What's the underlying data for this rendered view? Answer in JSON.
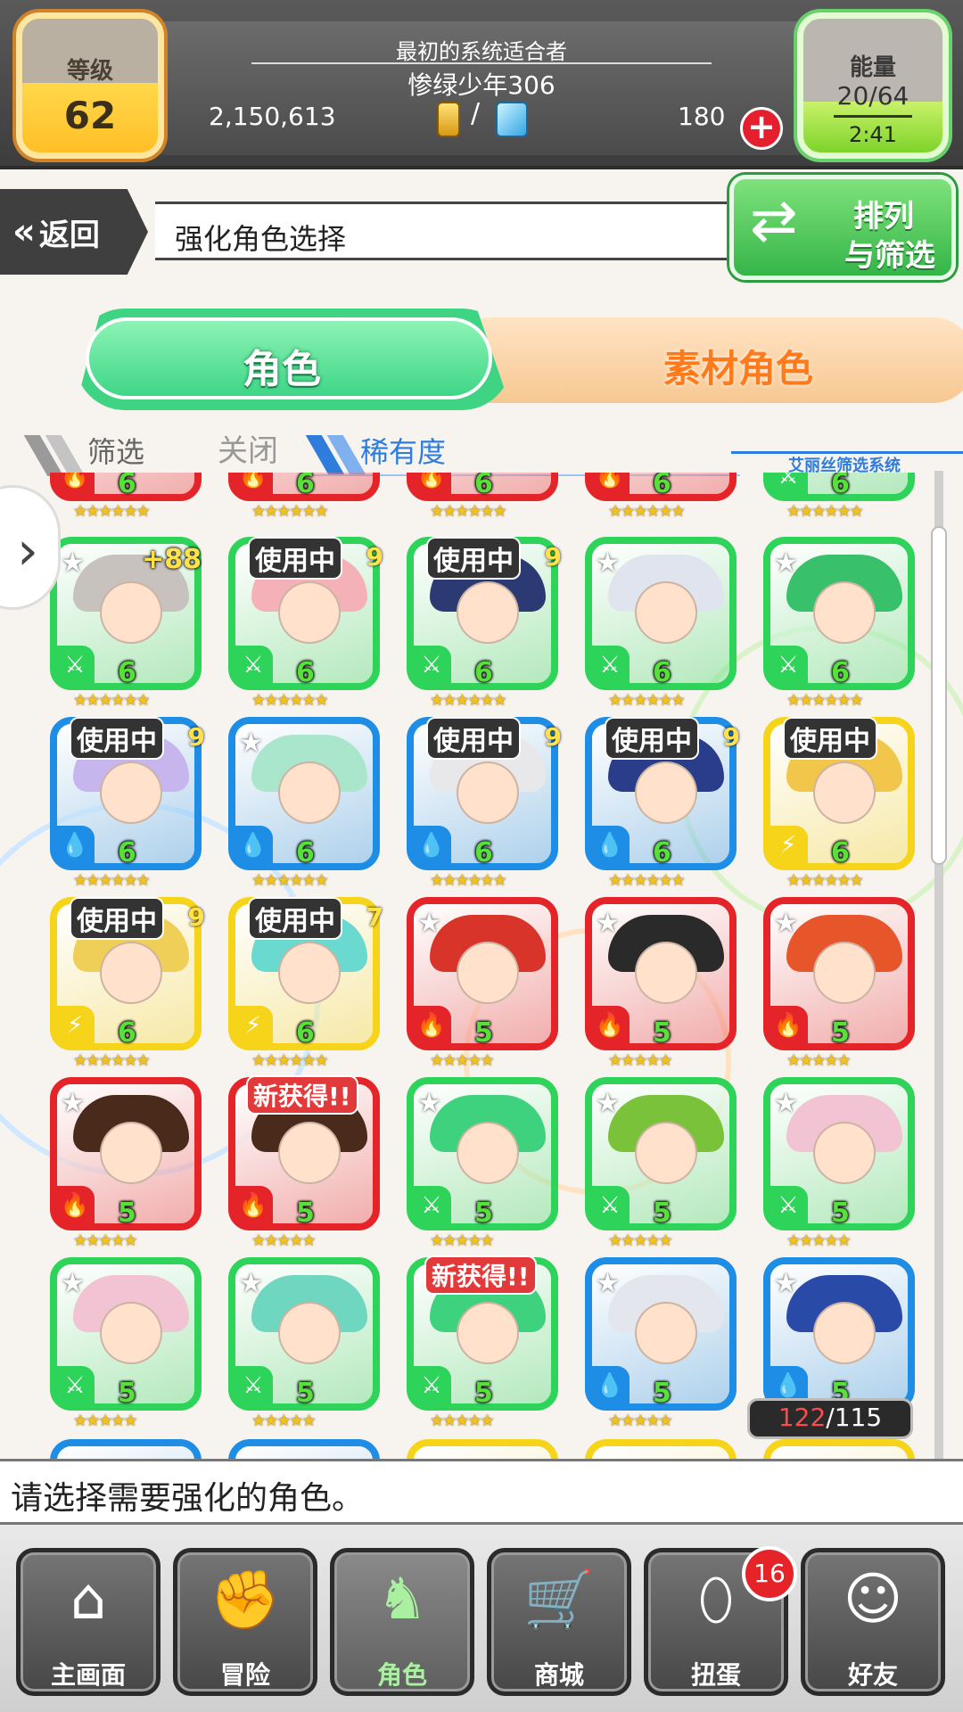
{
  "header": {
    "level_label": "等级",
    "level_value": "62",
    "subtitle": "最初的系统适合者",
    "player_name": "惨绿少年306",
    "gold": "2,150,613",
    "currency_separator": "/",
    "gems": "180",
    "energy_label": "能量",
    "energy_value": "20/64",
    "energy_timer": "2:41",
    "plus_icon": "+"
  },
  "nav": {
    "back_label": "返回",
    "back_icon": "«",
    "page_title": "强化角色选择",
    "sort_label_line1": "排列",
    "sort_label_line2": "与筛选"
  },
  "tabs": {
    "character": "角色",
    "material": "素材角色"
  },
  "filter": {
    "filter_label": "筛选",
    "state_label": "关闭",
    "sort_by_label": "稀有度",
    "system_label": "艾丽丝筛选系统"
  },
  "side_arrow": "›",
  "grid": {
    "colors": {
      "green": "#2ed45a",
      "blue": "#1d8de6",
      "red": "#e5242a",
      "yellow": "#f6d41a"
    },
    "partial_top_row": [
      {
        "color": "red",
        "level": "6"
      },
      {
        "color": "red",
        "level": "6"
      },
      {
        "color": "red",
        "level": "6"
      },
      {
        "color": "red",
        "level": "6"
      },
      {
        "color": "green",
        "level": "6"
      }
    ],
    "rows": [
      [
        {
          "color": "green",
          "level": "6",
          "star": true,
          "plus": "+88",
          "hair": "#c7c2be"
        },
        {
          "color": "green",
          "level": "6",
          "badge": "使用中",
          "badge_sub": "9",
          "hair": "#f4b2b8"
        },
        {
          "color": "green",
          "level": "6",
          "badge": "使用中",
          "badge_sub": "9",
          "hair": "#2b3a72"
        },
        {
          "color": "green",
          "level": "6",
          "star": true,
          "hair": "#e0e4ee"
        },
        {
          "color": "green",
          "level": "6",
          "star": true,
          "hair": "#39c06a"
        }
      ],
      [
        {
          "color": "blue",
          "level": "6",
          "badge": "使用中",
          "badge_sub": "9",
          "hair": "#c7b6ee"
        },
        {
          "color": "blue",
          "level": "6",
          "star": true,
          "hair": "#a9e6cc"
        },
        {
          "color": "blue",
          "level": "6",
          "badge": "使用中",
          "badge_sub": "9",
          "hair": "#e8e8ea"
        },
        {
          "color": "blue",
          "level": "6",
          "badge": "使用中",
          "badge_sub": "9",
          "hair": "#2a3d8a"
        },
        {
          "color": "yellow",
          "level": "6",
          "badge": "使用中",
          "hair": "#f2c64a"
        }
      ],
      [
        {
          "color": "yellow",
          "level": "6",
          "badge": "使用中",
          "badge_sub": "9",
          "hair": "#f0cf58"
        },
        {
          "color": "yellow",
          "level": "6",
          "badge": "使用中",
          "badge_sub": "7",
          "hair": "#6ad9cf"
        },
        {
          "color": "red",
          "level": "5",
          "star": true,
          "hair": "#d9342a"
        },
        {
          "color": "red",
          "level": "5",
          "star": true,
          "hair": "#2a2a2a"
        },
        {
          "color": "red",
          "level": "5",
          "star": true,
          "hair": "#e6562a"
        }
      ],
      [
        {
          "color": "red",
          "level": "5",
          "star": true,
          "hair": "#4a2a1a"
        },
        {
          "color": "red",
          "level": "5",
          "new": "新获得!!",
          "hair": "#4a2a1a"
        },
        {
          "color": "green",
          "level": "5",
          "star": true,
          "hair": "#3fd27e"
        },
        {
          "color": "green",
          "level": "5",
          "star": true,
          "hair": "#7ac23a"
        },
        {
          "color": "green",
          "level": "5",
          "star": true,
          "hair": "#f2c3d2"
        }
      ],
      [
        {
          "color": "green",
          "level": "5",
          "star": true,
          "hair": "#f2c3d2"
        },
        {
          "color": "green",
          "level": "5",
          "star": true,
          "hair": "#6fd6c0"
        },
        {
          "color": "green",
          "level": "5",
          "new": "新获得!!",
          "hair": "#3fd27e"
        },
        {
          "color": "blue",
          "level": "5",
          "star": true,
          "hair": "#e4e6ee"
        },
        {
          "color": "blue",
          "level": "5",
          "star": true,
          "hair": "#2a4aa8"
        }
      ]
    ],
    "partial_bottom_row": [
      {
        "color": "blue"
      },
      {
        "color": "blue"
      },
      {
        "color": "yellow"
      },
      {
        "color": "yellow"
      },
      {
        "color": "yellow"
      }
    ],
    "star_text": "★★★★★",
    "star_icon": "★"
  },
  "counter": {
    "current": "122",
    "max": "/115"
  },
  "message": "请选择需要强化的角色。",
  "bottom_nav": [
    {
      "label": "主画面",
      "icon": "home-icon",
      "glyph": "⌂"
    },
    {
      "label": "冒险",
      "icon": "handshake-icon",
      "glyph": "✊"
    },
    {
      "label": "角色",
      "icon": "rabbit-icon",
      "glyph": "♞",
      "active": true
    },
    {
      "label": "商城",
      "icon": "cart-icon",
      "glyph": "🛒"
    },
    {
      "label": "扭蛋",
      "icon": "egg-icon",
      "glyph": "⬯"
    },
    {
      "label": "好友",
      "icon": "friends-icon",
      "glyph": "☺"
    }
  ],
  "gacha_badge": "16"
}
